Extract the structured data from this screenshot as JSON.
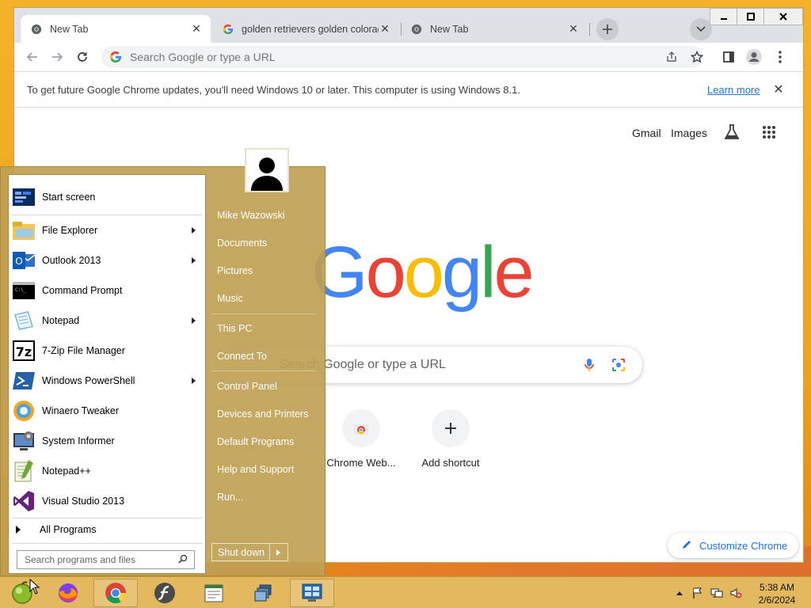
{
  "chrome": {
    "tabs": [
      {
        "title": "New Tab",
        "active": true
      },
      {
        "title": "golden retrievers golden colorad",
        "active": false
      },
      {
        "title": "New Tab",
        "active": false
      }
    ],
    "omnibox_placeholder": "Search Google or type a URL",
    "infobar": {
      "message": "To get future Google Chrome updates, you'll need Windows 10 or later. This computer is using Windows 8.1.",
      "link": "Learn more"
    },
    "ntp": {
      "links": [
        "Gmail",
        "Images"
      ],
      "logo_letters": [
        "G",
        "o",
        "o",
        "g",
        "l",
        "e"
      ],
      "logo_colors": [
        "#4285f4",
        "#ea4335",
        "#fbbc05",
        "#4285f4",
        "#34a853",
        "#ea4335"
      ],
      "search_placeholder": "Search Google or type a URL",
      "shortcuts": [
        {
          "label": "Chrome Web...",
          "icon": "chrome-web-store-icon"
        },
        {
          "label": "Add shortcut",
          "icon": "plus-icon"
        }
      ],
      "customize_label": "Customize Chrome"
    }
  },
  "start_menu": {
    "left_items": [
      {
        "label": "Start screen",
        "icon": "start-screen-icon",
        "submenu": false
      },
      {
        "label": "File Explorer",
        "icon": "file-explorer-icon",
        "submenu": true
      },
      {
        "label": "Outlook 2013",
        "icon": "outlook-icon",
        "submenu": true
      },
      {
        "label": "Command Prompt",
        "icon": "command-prompt-icon",
        "submenu": false
      },
      {
        "label": "Notepad",
        "icon": "notepad-icon",
        "submenu": true
      },
      {
        "label": "7-Zip File Manager",
        "icon": "7zip-icon",
        "submenu": false
      },
      {
        "label": "Windows PowerShell",
        "icon": "powershell-icon",
        "submenu": true
      },
      {
        "label": "Winaero Tweaker",
        "icon": "winaero-tweaker-icon",
        "submenu": false
      },
      {
        "label": "System Informer",
        "icon": "system-informer-icon",
        "submenu": false
      },
      {
        "label": "Notepad++",
        "icon": "notepadpp-icon",
        "submenu": false
      },
      {
        "label": "Visual Studio 2013",
        "icon": "visual-studio-icon",
        "submenu": false
      }
    ],
    "all_programs": "All Programs",
    "search_placeholder": "Search programs and files",
    "right_items": [
      "Mike Wazowski",
      "Documents",
      "Pictures",
      "Music",
      "This PC",
      "Connect To",
      "Control Panel",
      "Devices and Printers",
      "Default Programs",
      "Help and Support",
      "Run..."
    ],
    "shutdown_label": "Shut down"
  },
  "taskbar": {
    "apps": [
      "start-orb-icon",
      "firefox-icon",
      "chrome-icon",
      "flash-icon",
      "word-doc-icon",
      "task-view-icon",
      "control-panel-icon"
    ],
    "clock_time": "5:38 AM",
    "clock_date": "2/6/2024"
  },
  "colors": {
    "accent_blue": "#1a73e8",
    "start_menu_bg": "#bfa054",
    "taskbar_bg": "#e2ba60",
    "wallpaper": "#f2a920"
  }
}
